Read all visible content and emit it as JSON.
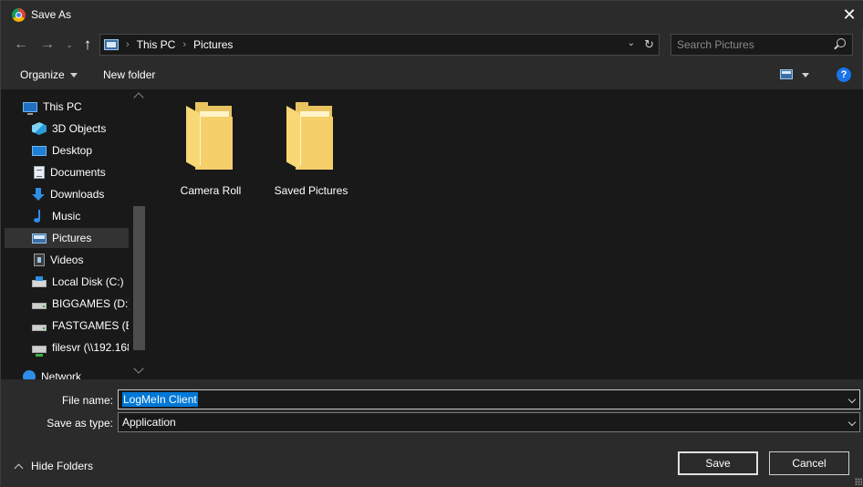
{
  "window": {
    "title": "Save As",
    "close_icon": "close-icon"
  },
  "nav": {
    "back_icon": "arrow-left-icon",
    "forward_icon": "arrow-right-icon",
    "recent_icon": "chevron-down-icon",
    "up_icon": "arrow-up-icon",
    "breadcrumb": [
      "This PC",
      "Pictures"
    ],
    "refresh_icon": "refresh-icon"
  },
  "search": {
    "placeholder": "Search Pictures",
    "value": ""
  },
  "toolbar": {
    "organize_label": "Organize",
    "new_folder_label": "New folder",
    "view_icon": "view-options-icon",
    "help_label": "?"
  },
  "sidebar": {
    "items": [
      {
        "label": "This PC",
        "icon": "computer-icon",
        "level": 0
      },
      {
        "label": "3D Objects",
        "icon": "cube-icon",
        "level": 1
      },
      {
        "label": "Desktop",
        "icon": "desktop-icon",
        "level": 1
      },
      {
        "label": "Documents",
        "icon": "document-icon",
        "level": 1
      },
      {
        "label": "Downloads",
        "icon": "download-icon",
        "level": 1
      },
      {
        "label": "Music",
        "icon": "music-icon",
        "level": 1
      },
      {
        "label": "Pictures",
        "icon": "pictures-icon",
        "level": 1,
        "selected": true
      },
      {
        "label": "Videos",
        "icon": "video-icon",
        "level": 1
      },
      {
        "label": "Local Disk (C:)",
        "icon": "local-disk-icon",
        "level": 1
      },
      {
        "label": "BIGGAMES (D:)",
        "icon": "drive-icon",
        "level": 1
      },
      {
        "label": "FASTGAMES (E:)",
        "icon": "drive-icon",
        "level": 1
      },
      {
        "label": "filesvr (\\\\192.168",
        "icon": "network-drive-icon",
        "level": 1
      },
      {
        "label": "Network",
        "icon": "network-icon",
        "level": 0
      }
    ]
  },
  "folders": [
    {
      "name": "Camera Roll",
      "icon": "folder-icon"
    },
    {
      "name": "Saved Pictures",
      "icon": "folder-icon"
    }
  ],
  "form": {
    "file_name_label": "File name:",
    "file_name_value": "LogMeIn Client",
    "save_type_label": "Save as type:",
    "save_type_value": "Application",
    "hide_folders_label": "Hide Folders",
    "save_label": "Save",
    "cancel_label": "Cancel"
  },
  "colors": {
    "accent": "#0078d7",
    "help": "#1a73e8",
    "folder": "#f8d775",
    "background": "#2b2b2b",
    "pane": "#191919"
  }
}
